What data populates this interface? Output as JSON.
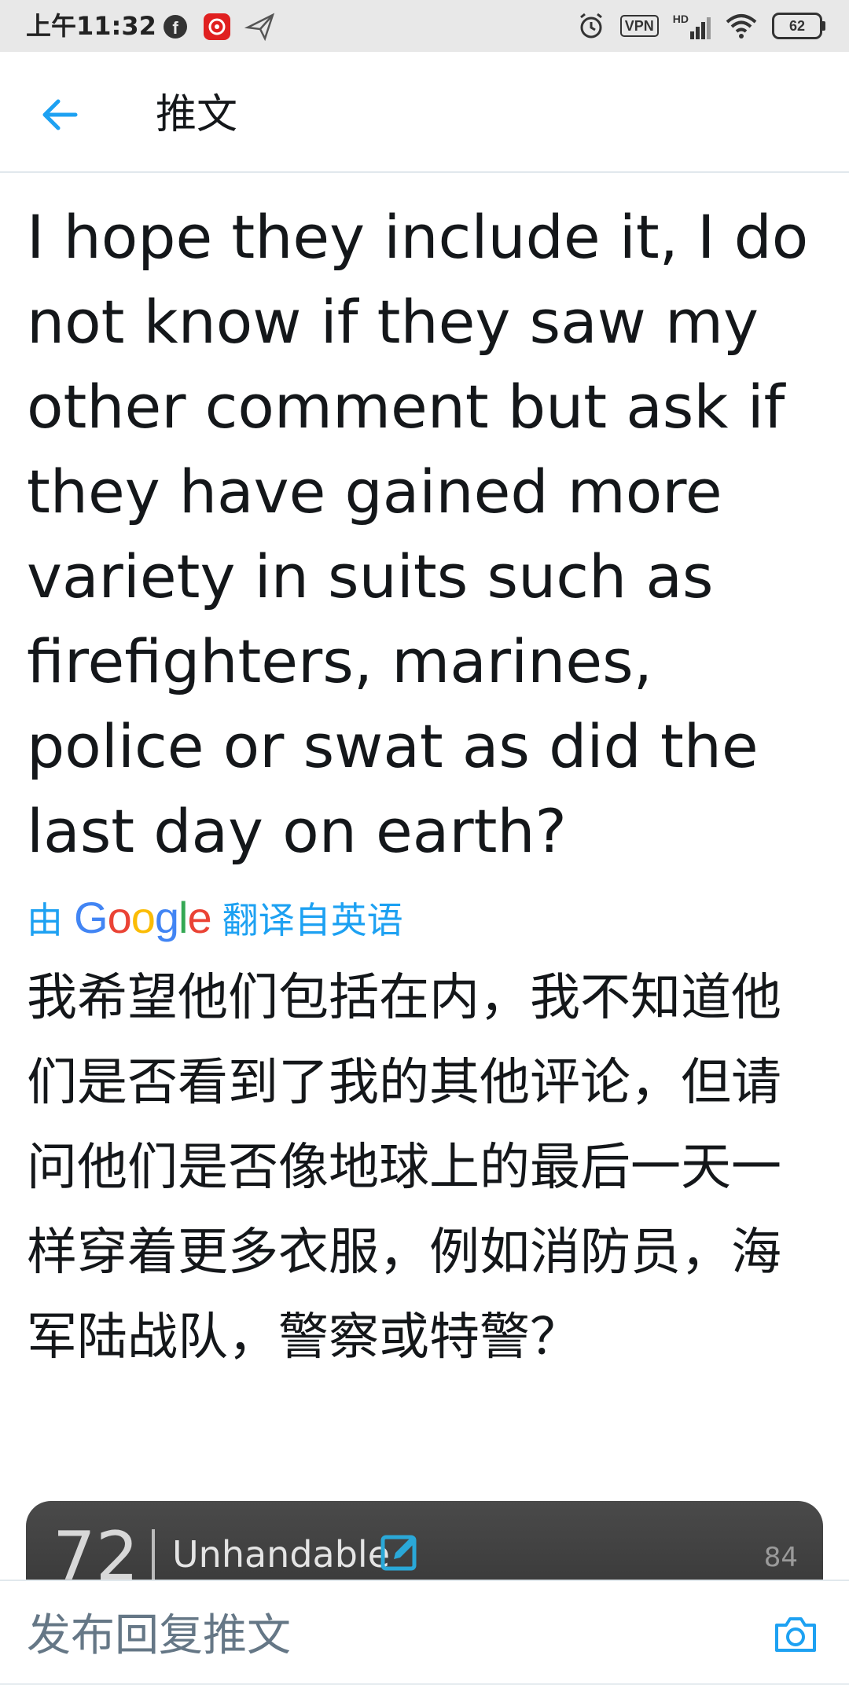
{
  "status_bar": {
    "time": "上午11:32",
    "vpn_label": "VPN",
    "network_label": "HD",
    "battery_level": "62"
  },
  "header": {
    "title": "推文"
  },
  "tweet": {
    "text": "I hope they include it, I do not know if they saw my other comment but ask if they have gained more variety in suits such as firefighters, marines, police or swat as did the last day on earth?",
    "translation_prefix": "由",
    "translation_provider": "Google",
    "translation_suffix": "翻译自英语",
    "translated_text": "我希望他们包括在内，我不知道他们是否看到了我的其他评论，但请问他们是否像地球上的最后一天一样穿着更多衣服，例如消防员，海军陆战队，警察或特警？"
  },
  "media": {
    "number": "72",
    "label": "Unhandable",
    "max": "84",
    "progress": 0.6
  },
  "reply": {
    "placeholder": "发布回复推文"
  },
  "colors": {
    "accent": "#1da1f2",
    "text": "#14171a",
    "secondary": "#657786"
  }
}
